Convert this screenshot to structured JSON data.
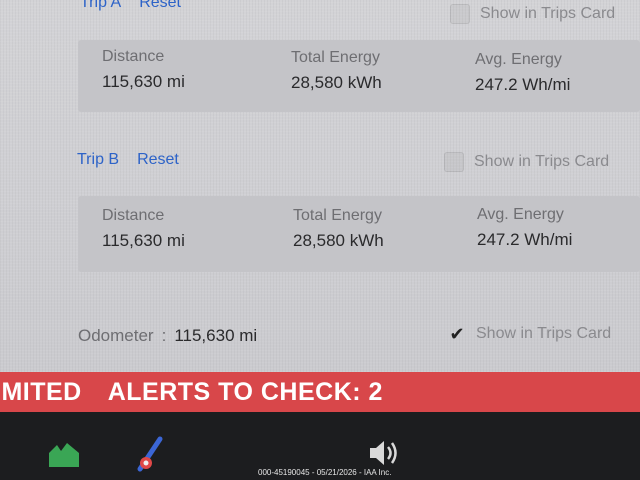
{
  "trip_a": {
    "title": "Trip A",
    "reset_label": "Reset",
    "show_in_card_label": "Show in Trips Card",
    "show_in_card_checked": false,
    "stats": {
      "distance_label": "Distance",
      "distance_value": "115,630 mi",
      "energy_label": "Total Energy",
      "energy_value": "28,580 kWh",
      "avg_label": "Avg. Energy",
      "avg_value": "247.2 Wh/mi"
    }
  },
  "trip_b": {
    "title": "Trip B",
    "reset_label": "Reset",
    "show_in_card_label": "Show in Trips Card",
    "show_in_card_checked": false,
    "stats": {
      "distance_label": "Distance",
      "distance_value": "115,630 mi",
      "energy_label": "Total Energy",
      "energy_value": "28,580 kWh",
      "avg_label": "Avg. Energy",
      "avg_value": "247.2 Wh/mi"
    }
  },
  "odometer": {
    "label": "Odometer",
    "separator": ":",
    "value": "115,630 mi",
    "show_in_card_label": "Show in Trips Card",
    "show_in_card_checked": true,
    "check_glyph": "✔"
  },
  "alert_banner": {
    "prefix_text": "IMITED",
    "alerts_text": "ALERTS TO CHECK: 2",
    "color": "#d8474a"
  },
  "dock": {
    "icons": [
      "car-icon",
      "wiper-icon",
      "volume-icon"
    ]
  },
  "watermark": {
    "text": "000-45190045 - 05/21/2026 - IAA Inc."
  },
  "colors": {
    "link": "#2d63c8",
    "screen_bg": "#d0d0d4",
    "dock_bg": "#1c1d1f"
  }
}
